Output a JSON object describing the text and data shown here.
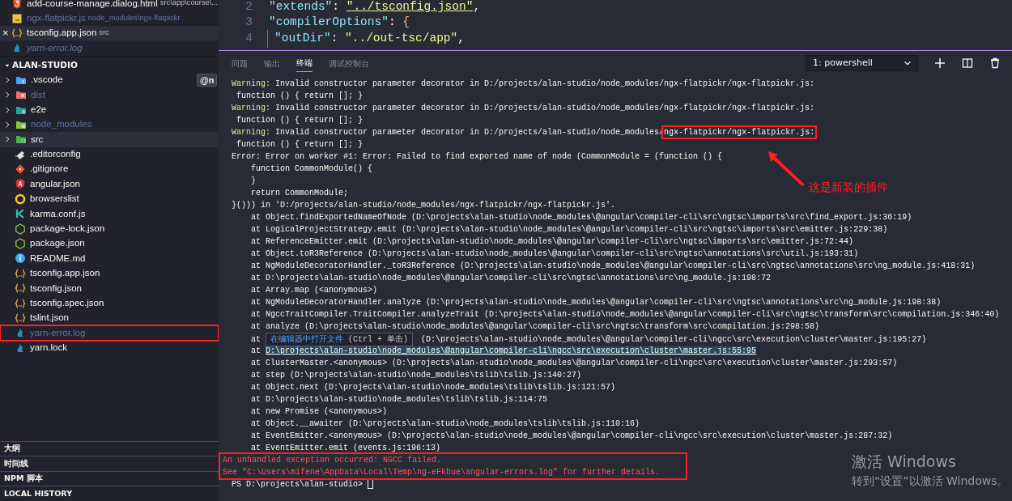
{
  "open_editors": [
    {
      "kind": "html",
      "name": "add-course-manage.dialog.html",
      "description": "src\\app\\course\\...",
      "preview": false,
      "selected": false,
      "dimmed": false
    },
    {
      "kind": "js",
      "name": "ngx-flatpickr.js",
      "description": "node_modules\\ngx-flatpickr",
      "preview": false,
      "selected": false,
      "dimmed": true
    },
    {
      "kind": "braces",
      "name": "tsconfig.app.json",
      "description": "src",
      "preview": false,
      "selected": true,
      "dimmed": false,
      "close": "×"
    },
    {
      "kind": "yarn",
      "name": "yarn-error.log",
      "preview": true,
      "selected": false,
      "dimmed": true
    }
  ],
  "explorer": {
    "title": "ALAN-STUDIO",
    "badge": "@n",
    "items": [
      {
        "kind": "vscode",
        "name": ".vscode",
        "dimmed": false,
        "annotated": false,
        "selected": false
      },
      {
        "kind": "dist",
        "name": "dist",
        "dimmed": true,
        "annotated": false,
        "selected": false
      },
      {
        "kind": "e2e",
        "name": "e2e",
        "dimmed": false,
        "annotated": false,
        "selected": false
      },
      {
        "kind": "node",
        "name": "node_modules",
        "dimmed": true,
        "annotated": false,
        "selected": false
      },
      {
        "kind": "src",
        "name": "src",
        "dimmed": false,
        "annotated": false,
        "selected": true
      },
      {
        "kind": "editorconfig",
        "name": ".editorconfig",
        "dimmed": false,
        "annotated": false,
        "selected": false
      },
      {
        "kind": "git",
        "name": ".gitignore",
        "dimmed": false,
        "annotated": false,
        "selected": false
      },
      {
        "kind": "angular",
        "name": "angular.json",
        "dimmed": false,
        "annotated": false,
        "selected": false
      },
      {
        "kind": "browsers",
        "name": "browserslist",
        "dimmed": false,
        "annotated": false,
        "selected": false
      },
      {
        "kind": "karma",
        "name": "karma.conf.js",
        "dimmed": false,
        "annotated": false,
        "selected": false
      },
      {
        "kind": "nodejs",
        "name": "package-lock.json",
        "dimmed": false,
        "annotated": false,
        "selected": false
      },
      {
        "kind": "nodejs",
        "name": "package.json",
        "dimmed": false,
        "annotated": false,
        "selected": false
      },
      {
        "kind": "info",
        "name": "README.md",
        "dimmed": false,
        "annotated": false,
        "selected": false
      },
      {
        "kind": "braces",
        "name": "tsconfig.app.json",
        "dimmed": false,
        "annotated": false,
        "selected": false
      },
      {
        "kind": "braces",
        "name": "tsconfig.json",
        "dimmed": false,
        "annotated": false,
        "selected": false
      },
      {
        "kind": "braces",
        "name": "tsconfig.spec.json",
        "dimmed": false,
        "annotated": false,
        "selected": false
      },
      {
        "kind": "braces",
        "name": "tslint.json",
        "dimmed": false,
        "annotated": false,
        "selected": false
      },
      {
        "kind": "yarn",
        "name": "yarn-error.log",
        "dimmed": true,
        "annotated": true,
        "selected": false
      },
      {
        "kind": "yarn",
        "name": "yarn.lock",
        "dimmed": false,
        "annotated": false,
        "selected": false
      }
    ]
  },
  "sidebar_sections": [
    "大纲",
    "时间线",
    "NPM 脚本",
    "LOCAL HISTORY"
  ],
  "editor": {
    "lines": [
      {
        "number": "2",
        "indent": false,
        "parts": [
          {
            "kind": "key",
            "text": "\"extends\""
          },
          {
            "kind": "punct",
            "text": ": "
          },
          {
            "kind": "link",
            "text": "\"../tsconfig.json\""
          },
          {
            "kind": "punct",
            "text": ","
          }
        ]
      },
      {
        "number": "3",
        "indent": false,
        "parts": [
          {
            "kind": "key",
            "text": "\"compilerOptions\""
          },
          {
            "kind": "punct",
            "text": ": "
          },
          {
            "kind": "brace",
            "text": "{"
          }
        ]
      },
      {
        "number": "4",
        "indent": true,
        "parts": [
          {
            "kind": "key",
            "text": "\"outDir\""
          },
          {
            "kind": "punct",
            "text": ": "
          },
          {
            "kind": "string",
            "text": "\"../out-tsc/app\""
          },
          {
            "kind": "punct",
            "text": ","
          }
        ]
      }
    ]
  },
  "panel": {
    "tabs": [
      {
        "label": "问题",
        "selected": false
      },
      {
        "label": "输出",
        "selected": false
      },
      {
        "label": "终端",
        "selected": true
      },
      {
        "label": "调试控制台",
        "selected": false
      }
    ],
    "terminal_select": "1: powershell"
  },
  "terminal": {
    "lines": [
      {
        "kind": "warning",
        "prefix": "Warning:",
        "text": " Invalid constructor parameter decorator in D:/projects/alan-studio/node_modules/ngx-flatpickr/ngx-flatpickr.js:"
      },
      {
        "kind": "plain",
        "text": " function () { return []; }"
      },
      {
        "kind": "warning",
        "prefix": "Warning:",
        "text": " Invalid constructor parameter decorator in D:/projects/alan-studio/node_modules/ngx-flatpickr/ngx-flatpickr.js:"
      },
      {
        "kind": "plain",
        "text": " function () { return []; }"
      },
      {
        "kind": "warning",
        "prefix": "Warning:",
        "text": " Invalid constructor parameter decorator in D:/projects/alan-studio/node_modules/",
        "highlight": "ngx-flatpickr/ngx-flatpickr.js:"
      },
      {
        "kind": "plain",
        "text": " function () { return []; }"
      },
      {
        "kind": "plain",
        "text": "Error: Error on worker #1: Error: Failed to find exported name of node (CommonModule = (function () {"
      },
      {
        "kind": "plain",
        "text": "    function CommonModule() {"
      },
      {
        "kind": "plain",
        "text": "    }"
      },
      {
        "kind": "plain",
        "text": "    return CommonModule;"
      },
      {
        "kind": "plain",
        "text": "}())) in 'D:/projects/alan-studio/node_modules/ngx-flatpickr/ngx-flatpickr.js'."
      },
      {
        "kind": "plain",
        "text": "    at Object.findExportedNameOfNode (D:\\projects\\alan-studio\\node_modules\\@angular\\compiler-cli\\src\\ngtsc\\imports\\src\\find_export.js:36:19)"
      },
      {
        "kind": "plain",
        "text": "    at LogicalProjectStrategy.emit (D:\\projects\\alan-studio\\node_modules\\@angular\\compiler-cli\\src\\ngtsc\\imports\\src\\emitter.js:229:38)"
      },
      {
        "kind": "plain",
        "text": "    at ReferenceEmitter.emit (D:\\projects\\alan-studio\\node_modules\\@angular\\compiler-cli\\src\\ngtsc\\imports\\src\\emitter.js:72:44)"
      },
      {
        "kind": "plain",
        "text": "    at Object.toR3Reference (D:\\projects\\alan-studio\\node_modules\\@angular\\compiler-cli\\src\\ngtsc\\annotations\\src\\util.js:193:31)"
      },
      {
        "kind": "plain",
        "text": "    at NgModuleDecoratorHandler._toR3Reference (D:\\projects\\alan-studio\\node_modules\\@angular\\compiler-cli\\src\\ngtsc\\annotations\\src\\ng_module.js:418:31)"
      },
      {
        "kind": "plain",
        "text": "    at D:\\projects\\alan-studio\\node_modules\\@angular\\compiler-cli\\src\\ngtsc\\annotations\\src\\ng_module.js:198:72"
      },
      {
        "kind": "plain",
        "text": "    at Array.map (<anonymous>)"
      },
      {
        "kind": "plain",
        "text": "    at NgModuleDecoratorHandler.analyze (D:\\projects\\alan-studio\\node_modules\\@angular\\compiler-cli\\src\\ngtsc\\annotations\\src\\ng_module.js:198:38)"
      },
      {
        "kind": "plain",
        "text": "    at NgccTraitCompiler.TraitCompiler.analyzeTrait (D:\\projects\\alan-studio\\node_modules\\@angular\\compiler-cli\\src\\ngtsc\\transform\\src\\compilation.js:346:40)"
      },
      {
        "kind": "plain",
        "text": "    at analyze (D:\\projects\\alan-studio\\node_modules\\@angular\\compiler-cli\\src\\ngtsc\\transform\\src\\compilation.js:298:58)"
      },
      {
        "kind": "tooltip",
        "text": "    at ",
        "tooltip": "在编辑器中打开文件",
        "tooltip_hint": "(Ctrl + 单击)",
        "rest": " (D:\\projects\\alan-studio\\node_modules\\@angular\\compiler-cli\\ngcc\\src\\execution\\cluster\\master.js:195:27)"
      },
      {
        "kind": "link",
        "text": "    at ",
        "link": "D:\\projects\\alan-studio\\node_modules\\@angular\\compiler-cli\\ngcc\\src\\execution\\cluster\\master.js:55:95"
      },
      {
        "kind": "plain",
        "text": "    at ClusterMaster.<anonymous> (D:\\projects\\alan-studio\\node_modules\\@angular\\compiler-cli\\ngcc\\src\\execution\\cluster\\master.js:293:57)"
      },
      {
        "kind": "plain",
        "text": "    at step (D:\\projects\\alan-studio\\node_modules\\tslib\\tslib.js:140:27)"
      },
      {
        "kind": "plain",
        "text": "    at Object.next (D:\\projects\\alan-studio\\node_modules\\tslib\\tslib.js:121:57)"
      },
      {
        "kind": "plain",
        "text": "    at D:\\projects\\alan-studio\\node_modules\\tslib\\tslib.js:114:75"
      },
      {
        "kind": "plain",
        "text": "    at new Promise (<anonymous>)"
      },
      {
        "kind": "plain",
        "text": "    at Object.__awaiter (D:\\projects\\alan-studio\\node_modules\\tslib\\tslib.js:110:16)"
      },
      {
        "kind": "plain",
        "text": "    at EventEmitter.<anonymous> (D:\\projects\\alan-studio\\node_modules\\@angular\\compiler-cli\\ngcc\\src\\execution\\cluster\\master.js:287:32)"
      },
      {
        "kind": "plain",
        "text": "    at EventEmitter.emit (events.js:196:13)"
      }
    ],
    "error_block": [
      "An unhandled exception occurred: NGCC failed.",
      "See \"C:\\Users\\mifene\\AppData\\Local\\Temp\\ng-eFkbue\\angular-errors.log\" for further details."
    ],
    "prompt": "PS D:\\projects\\alan-studio> ",
    "annotation": "这是新装的插件"
  },
  "os_overlay": {
    "title": "激活 Windows",
    "hint": "转到“设置”以激活 Windows。"
  }
}
